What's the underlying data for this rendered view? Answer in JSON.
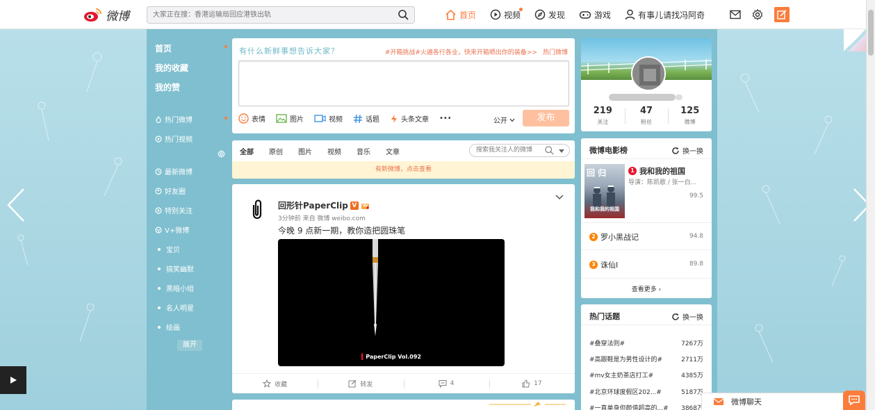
{
  "header": {
    "logo_text": "微博",
    "search_placeholder": "大家正在搜：香港运输局回应港铁出轨",
    "nav": [
      {
        "label": "首页",
        "active": true
      },
      {
        "label": "视频"
      },
      {
        "label": "发现"
      },
      {
        "label": "游戏"
      },
      {
        "label": "有事儿请找冯阿奇"
      }
    ]
  },
  "left_nav": {
    "top_items": [
      "首页",
      "我的收藏",
      "我的赞"
    ],
    "hot_items": [
      "热门微博",
      "热门视频"
    ],
    "group_items": [
      "最新微博",
      "好友圈",
      "特别关注",
      "V+微博"
    ],
    "sub_items": [
      "宝贝",
      "搞笑幽默",
      "黑暗小组",
      "名人明星",
      "绘画"
    ],
    "expand": "展开"
  },
  "composer": {
    "prompt": "有什么新鲜事想告诉大家？",
    "hot_topic": "#开箱挑战#火遍各行各业，快来开箱晒出你的装备>>",
    "hot_link": "热门微博",
    "tools": [
      "表情",
      "图片",
      "视频",
      "话题",
      "头条文章"
    ],
    "more": "•••",
    "visibility": "公开",
    "publish": "发布"
  },
  "feed_filter": {
    "tabs": [
      "全部",
      "原创",
      "图片",
      "视频",
      "音乐",
      "文章"
    ],
    "search_placeholder": "搜索我关注人的微博",
    "new_notice": "有新微博，点击查看"
  },
  "post": {
    "author": "回形针PaperClip",
    "vbadge": "V",
    "meta": "3分钟前 来自 微博 weibo.com",
    "text": "今晚 9 点新一期，教你造把圆珠笔",
    "video_caption": "PaperClip Vol.092",
    "actions": {
      "favorite": "收藏",
      "repost": "转发",
      "comment": "4",
      "like": "17"
    }
  },
  "profile": {
    "stats": [
      {
        "num": "219",
        "label": "关注"
      },
      {
        "num": "47",
        "label": "粉丝"
      },
      {
        "num": "125",
        "label": "微博"
      }
    ]
  },
  "movies": {
    "title": "微博电影榜",
    "refresh": "换一换",
    "poster_top": "回 归",
    "poster_bottom": "我和我的祖国",
    "items": [
      {
        "rank": "1",
        "name": "我和我的祖国",
        "director": "导演：陈凯歌 / 张一白...",
        "score": "99.5"
      },
      {
        "rank": "2",
        "name": "罗小黑战记",
        "score": "94.8"
      },
      {
        "rank": "3",
        "name": "诛仙Ⅰ",
        "score": "89.8"
      }
    ],
    "see_more": "查看更多 ›"
  },
  "topics": {
    "title": "热门话题",
    "refresh": "换一换",
    "items": [
      {
        "name": "#叠穿法则#",
        "count": "7267万"
      },
      {
        "name": "#高跟鞋是为男性设计的#",
        "count": "2711万"
      },
      {
        "name": "#mv女主奶茶店打工#",
        "count": "4385万"
      },
      {
        "name": "#北京环球度假区202...#",
        "count": "5187万"
      },
      {
        "name": "#一直单身但颜值超高的...#",
        "count": "3868万"
      }
    ]
  },
  "chat": {
    "label": "微博聊天"
  },
  "colors": {
    "accent": "#fa7d3c",
    "hot": "#eb7350",
    "bg": "#a9d6e2"
  }
}
